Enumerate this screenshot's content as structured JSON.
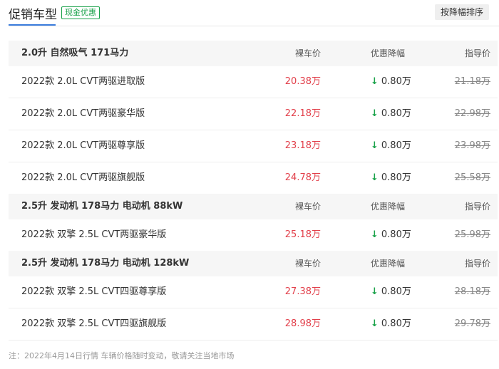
{
  "header": {
    "title": "促销车型",
    "badge": "现金优惠",
    "sort_button": "按降幅排序"
  },
  "groups": [
    {
      "name": "2.0升 自然吸气 171马力",
      "col_price": "裸车价",
      "col_discount": "优惠降幅",
      "col_guide": "指导价",
      "models": [
        {
          "name": "2022款 2.0L CVT两驱进取版",
          "price": "20.38万",
          "discount": "0.80万",
          "guide": "21.18万"
        },
        {
          "name": "2022款 2.0L CVT两驱豪华版",
          "price": "22.18万",
          "discount": "0.80万",
          "guide": "22.98万"
        },
        {
          "name": "2022款 2.0L CVT两驱尊享版",
          "price": "23.18万",
          "discount": "0.80万",
          "guide": "23.98万"
        },
        {
          "name": "2022款 2.0L CVT两驱旗舰版",
          "price": "24.78万",
          "discount": "0.80万",
          "guide": "25.58万"
        }
      ]
    },
    {
      "name": "2.5升 发动机 178马力 电动机 88kW",
      "col_price": "裸车价",
      "col_discount": "优惠降幅",
      "col_guide": "指导价",
      "models": [
        {
          "name": "2022款 双擎 2.5L CVT两驱豪华版",
          "price": "25.18万",
          "discount": "0.80万",
          "guide": "25.98万"
        }
      ]
    },
    {
      "name": "2.5升 发动机 178马力 电动机 128kW",
      "col_price": "裸车价",
      "col_discount": "优惠降幅",
      "col_guide": "指导价",
      "models": [
        {
          "name": "2022款 双擎 2.5L CVT四驱尊享版",
          "price": "27.38万",
          "discount": "0.80万",
          "guide": "28.18万"
        },
        {
          "name": "2022款 双擎 2.5L CVT四驱旗舰版",
          "price": "28.98万",
          "discount": "0.80万",
          "guide": "29.78万"
        }
      ]
    }
  ],
  "note": "注：2022年4月14日行情 车辆价格随时变动，敬请关注当地市场",
  "colors": {
    "accent": "#3b7ddd",
    "price": "#e2404b",
    "discount_arrow": "#1aa24a"
  },
  "icons": {
    "discount": "arrow-down-icon"
  }
}
